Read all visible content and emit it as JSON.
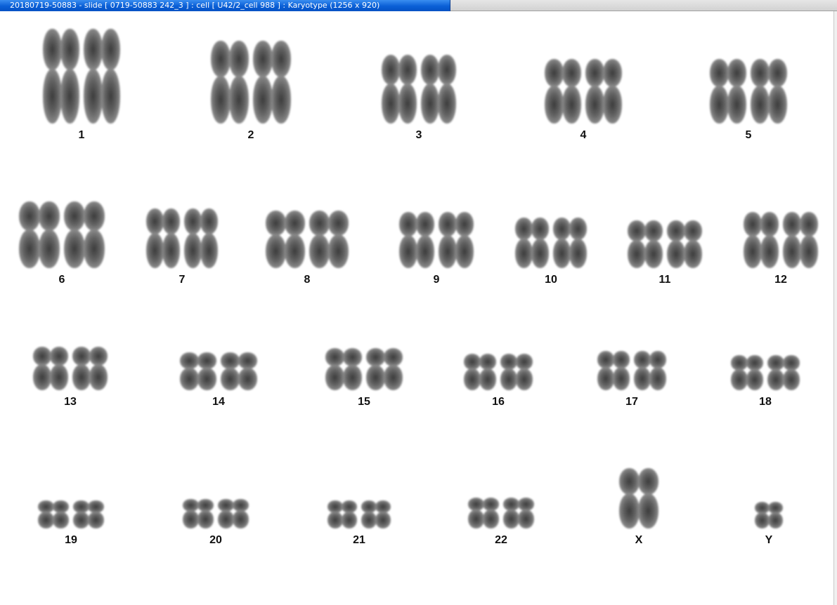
{
  "window": {
    "title": "20180719-50883 - slide [ 0719-50883 242_3 ] : cell [ U42/2_cell 988 ] : Karyotype  (1256 x 920)"
  },
  "karyotype": {
    "chromosomes": [
      {
        "label": "1",
        "copies": 2
      },
      {
        "label": "2",
        "copies": 2
      },
      {
        "label": "3",
        "copies": 2
      },
      {
        "label": "4",
        "copies": 2
      },
      {
        "label": "5",
        "copies": 2
      },
      {
        "label": "6",
        "copies": 2
      },
      {
        "label": "7",
        "copies": 2
      },
      {
        "label": "8",
        "copies": 2
      },
      {
        "label": "9",
        "copies": 2
      },
      {
        "label": "10",
        "copies": 2
      },
      {
        "label": "11",
        "copies": 2
      },
      {
        "label": "12",
        "copies": 2
      },
      {
        "label": "13",
        "copies": 2
      },
      {
        "label": "14",
        "copies": 2
      },
      {
        "label": "15",
        "copies": 2
      },
      {
        "label": "16",
        "copies": 2
      },
      {
        "label": "17",
        "copies": 2
      },
      {
        "label": "18",
        "copies": 2
      },
      {
        "label": "19",
        "copies": 2
      },
      {
        "label": "20",
        "copies": 2
      },
      {
        "label": "21",
        "copies": 2
      },
      {
        "label": "22",
        "copies": 2
      },
      {
        "label": "X",
        "copies": 1
      },
      {
        "label": "Y",
        "copies": 1
      }
    ]
  },
  "colors": {
    "titlebar_active": "#0a5fd6",
    "titlebar_text": "#ffffff",
    "chromosome": "#5a5a5a",
    "label_text": "#111111",
    "background": "#ffffff"
  }
}
